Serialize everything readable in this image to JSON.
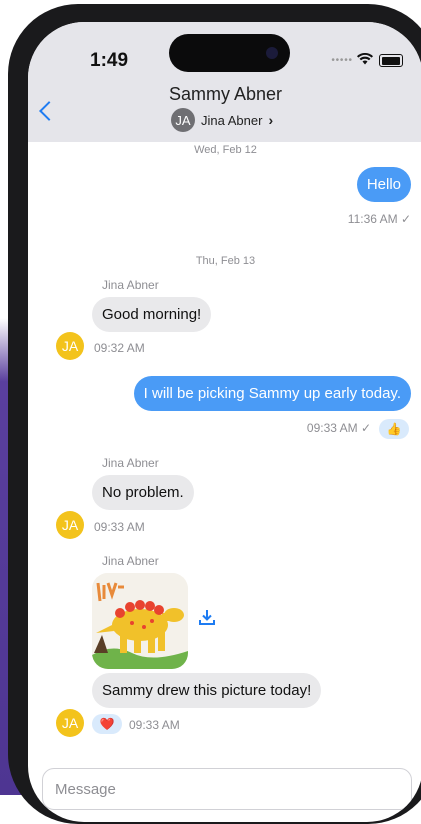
{
  "status_bar": {
    "time": "1:49"
  },
  "header": {
    "title": "Sammy Abner",
    "subtitle_name": "Jina Abner",
    "subtitle_initials": "JA"
  },
  "messages": {
    "date1": "Wed, Feb 12",
    "hello_text": "Hello",
    "hello_meta": "11:36 AM ✓",
    "date2": "Thu, Feb 13",
    "m1_sender": "Jina Abner",
    "m1_text": "Good morning!",
    "m1_time": "09:32 AM",
    "m1_initials": "JA",
    "out2_text": "I will be picking Sammy up early today.",
    "out2_meta": "09:33 AM ✓",
    "out2_reaction": "👍",
    "m2_sender": "Jina Abner",
    "m2_text": "No problem.",
    "m2_time": "09:33 AM",
    "m2_initials": "JA",
    "m3_sender": "Jina Abner",
    "m3_text": "Sammy drew this picture today!",
    "m3_time": "09:33 AM",
    "m3_initials": "JA",
    "m3_reaction": "❤️"
  },
  "composer": {
    "placeholder": "Message"
  },
  "colors": {
    "accent_blue": "#1e7cf2",
    "bubble_out": "#4a9bf6",
    "bubble_in": "#e9e9eb",
    "avatar_yellow": "#f3c31c",
    "header_bg": "#e5e5ea"
  }
}
